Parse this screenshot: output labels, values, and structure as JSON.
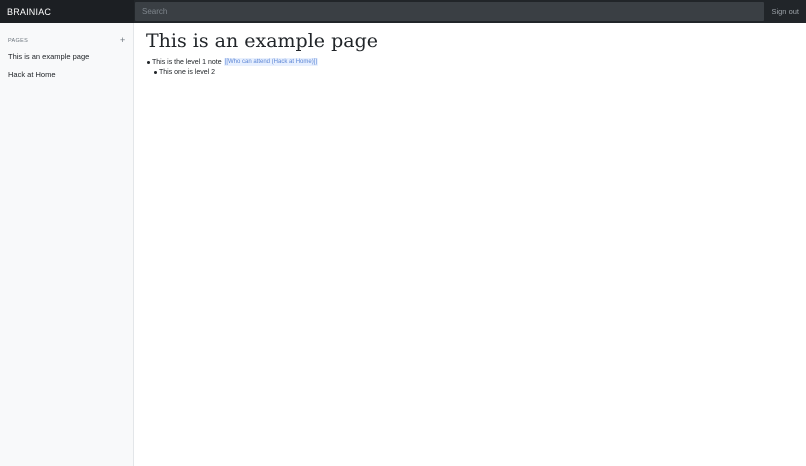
{
  "header": {
    "brand": "BRAINIAC",
    "search": {
      "placeholder": "Search",
      "value": ""
    },
    "sign_out_label": "Sign out"
  },
  "sidebar": {
    "heading": "PAGES",
    "add_icon": "plus-icon",
    "add_label": "+",
    "items": [
      {
        "label": "This is an example page"
      },
      {
        "label": "Hack at Home"
      }
    ]
  },
  "page": {
    "title": "This is an example page",
    "notes": [
      {
        "level": 1,
        "text": "This is the level 1 note",
        "link": "[[Who can attend (Hack at Home)]]"
      },
      {
        "level": 2,
        "text": "This one is level 2"
      }
    ]
  },
  "colors": {
    "topbar": "#212529",
    "search_bg": "#3a3f44",
    "sidebar_bg": "#f8f9fa",
    "link": "#5b85d6",
    "link_bg": "#e8f0fe"
  }
}
